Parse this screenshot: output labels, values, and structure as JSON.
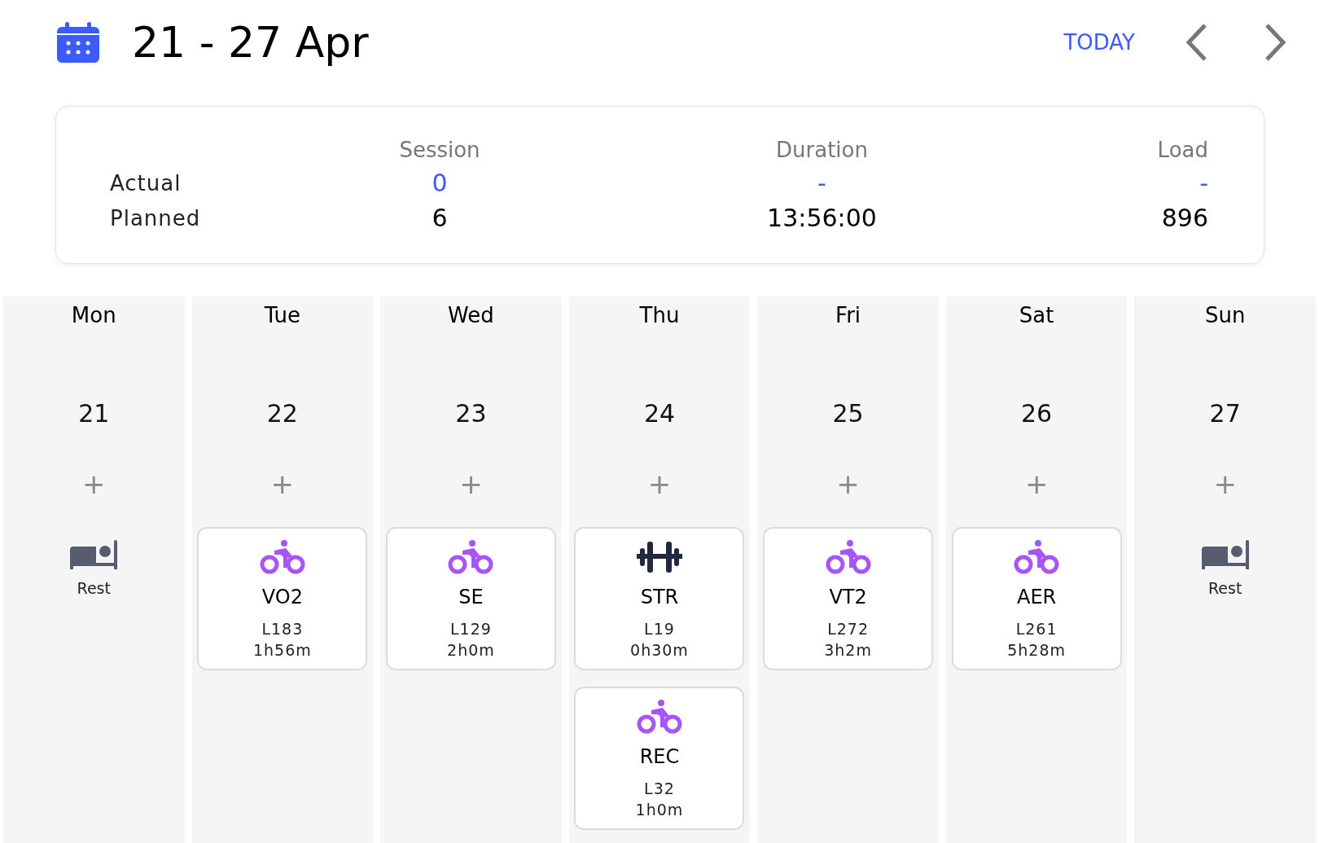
{
  "header": {
    "title": "21 - 27 Apr",
    "today_label": "TODAY"
  },
  "summary": {
    "columns": [
      "Session",
      "Duration",
      "Load"
    ],
    "rows": [
      {
        "label": "Actual",
        "kind": "actual",
        "values": [
          "0",
          "-",
          "-"
        ]
      },
      {
        "label": "Planned",
        "kind": "planned",
        "values": [
          "6",
          "13:56:00",
          "896"
        ]
      }
    ]
  },
  "days": [
    {
      "weekday": "Mon",
      "date": "21",
      "add": "+",
      "kind": "rest",
      "rest_label": "Rest"
    },
    {
      "weekday": "Tue",
      "date": "22",
      "add": "+",
      "kind": "training",
      "workouts": [
        {
          "kind": "bike",
          "name": "VO2",
          "load": "L183",
          "duration": "1h56m"
        }
      ]
    },
    {
      "weekday": "Wed",
      "date": "23",
      "add": "+",
      "kind": "training",
      "workouts": [
        {
          "kind": "bike",
          "name": "SE",
          "load": "L129",
          "duration": "2h0m"
        }
      ]
    },
    {
      "weekday": "Thu",
      "date": "24",
      "add": "+",
      "kind": "training",
      "workouts": [
        {
          "kind": "strength",
          "name": "STR",
          "load": "L19",
          "duration": "0h30m"
        },
        {
          "kind": "bike",
          "name": "REC",
          "load": "L32",
          "duration": "1h0m"
        }
      ]
    },
    {
      "weekday": "Fri",
      "date": "25",
      "add": "+",
      "kind": "training",
      "workouts": [
        {
          "kind": "bike",
          "name": "VT2",
          "load": "L272",
          "duration": "3h2m"
        }
      ]
    },
    {
      "weekday": "Sat",
      "date": "26",
      "add": "+",
      "kind": "training",
      "workouts": [
        {
          "kind": "bike",
          "name": "AER",
          "load": "L261",
          "duration": "5h28m"
        }
      ]
    },
    {
      "weekday": "Sun",
      "date": "27",
      "add": "+",
      "kind": "rest",
      "rest_label": "Rest"
    }
  ]
}
